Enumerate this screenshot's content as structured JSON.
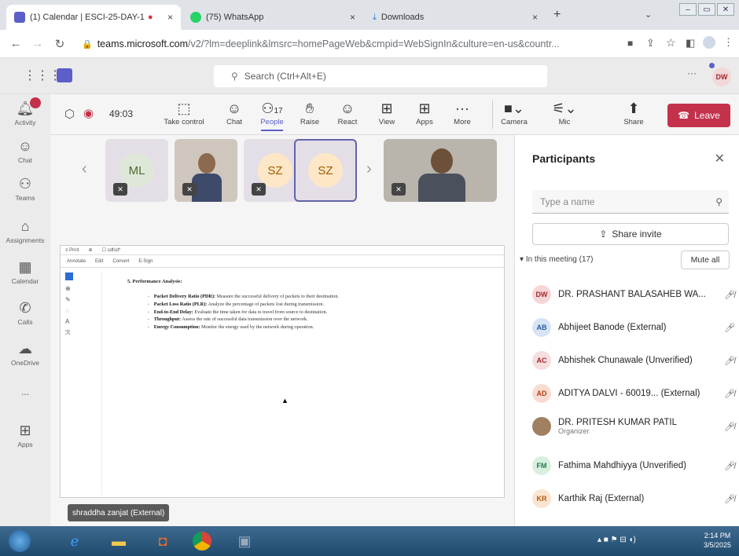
{
  "browser": {
    "tabs": [
      {
        "title": "(1) Calendar | ESCI-25-DAY-1",
        "active": true
      },
      {
        "title": "(75) WhatsApp",
        "active": false
      },
      {
        "title": "Downloads",
        "active": false
      }
    ],
    "new_tab": "+",
    "url_domain": "teams.microsoft.com",
    "url_rest": "/v2/?lm=deeplink&lmsrc=homePageWeb&cmpid=WebSignIn&culture=en-us&countr..."
  },
  "teams": {
    "search_placeholder": "Search (Ctrl+Alt+E)",
    "user_initials": "DW",
    "rail": [
      "Activity",
      "Chat",
      "Teams",
      "Assignments",
      "Calendar",
      "Calls",
      "OneDrive",
      "...",
      "Apps"
    ],
    "timer": "49:03",
    "toolbar": {
      "take_control": "Take control",
      "chat": "Chat",
      "people": "People",
      "people_count": "17",
      "raise": "Raise",
      "react": "React",
      "view": "View",
      "apps": "Apps",
      "more": "More",
      "camera": "Camera",
      "mic": "Mic",
      "share": "Share",
      "leave": "Leave"
    },
    "tiles": [
      "ML",
      "SZ",
      "SZ"
    ],
    "presenter_name": "shraddha zanjat (External)"
  },
  "shared_doc": {
    "heading": "5. Performance Analysis:",
    "bullets": [
      {
        "term": "Packet Delivery Ratio (PDR):",
        "text": " Measure the successful delivery of packets to their destination."
      },
      {
        "term": "Packet Loss Ratio (PLR):",
        "text": " Analyze the percentage of packets lost during transmission."
      },
      {
        "term": "End-to-End Delay:",
        "text": " Evaluate the time taken for data to travel from source to destination."
      },
      {
        "term": "Throughput:",
        "text": " Assess the rate of successful data transmission over the network."
      },
      {
        "term": "Energy Consumption:",
        "text": " Monitor the energy used by the network during operation."
      }
    ]
  },
  "participants": {
    "title": "Participants",
    "search_placeholder": "Type a name",
    "share_invite": "Share invite",
    "section": "In this meeting (17)",
    "mute_all": "Mute all",
    "list": [
      {
        "initials": "DW",
        "name": "DR. PRASHANT BALASAHEB WA...",
        "sub": "",
        "color": "#f6d6d6",
        "fg": "#a4262c"
      },
      {
        "initials": "AB",
        "name": "Abhijeet Banode (External)",
        "sub": "",
        "color": "#d6e4f5",
        "fg": "#2c5aa0"
      },
      {
        "initials": "AC",
        "name": "Abhishek Chunawale (Unverified)",
        "sub": "",
        "color": "#f6dede",
        "fg": "#a4262c"
      },
      {
        "initials": "AD",
        "name": "ADITYA DALVI - 60019...  (External)",
        "sub": "",
        "color": "#f8dcd2",
        "fg": "#b3401a"
      },
      {
        "initials": "",
        "name": "DR. PRITESH KUMAR PATIL",
        "sub": "Organizer",
        "color": "#a08060",
        "fg": "#fff"
      },
      {
        "initials": "FM",
        "name": "Fathima Mahdhiyya (Unverified)",
        "sub": "",
        "color": "#d9efe0",
        "fg": "#237b4b"
      },
      {
        "initials": "KR",
        "name": "Karthik Raj (External)",
        "sub": "",
        "color": "#fbe5d0",
        "fg": "#b35a10"
      }
    ]
  },
  "taskbar": {
    "time": "2:14 PM",
    "date": "3/5/2025"
  }
}
